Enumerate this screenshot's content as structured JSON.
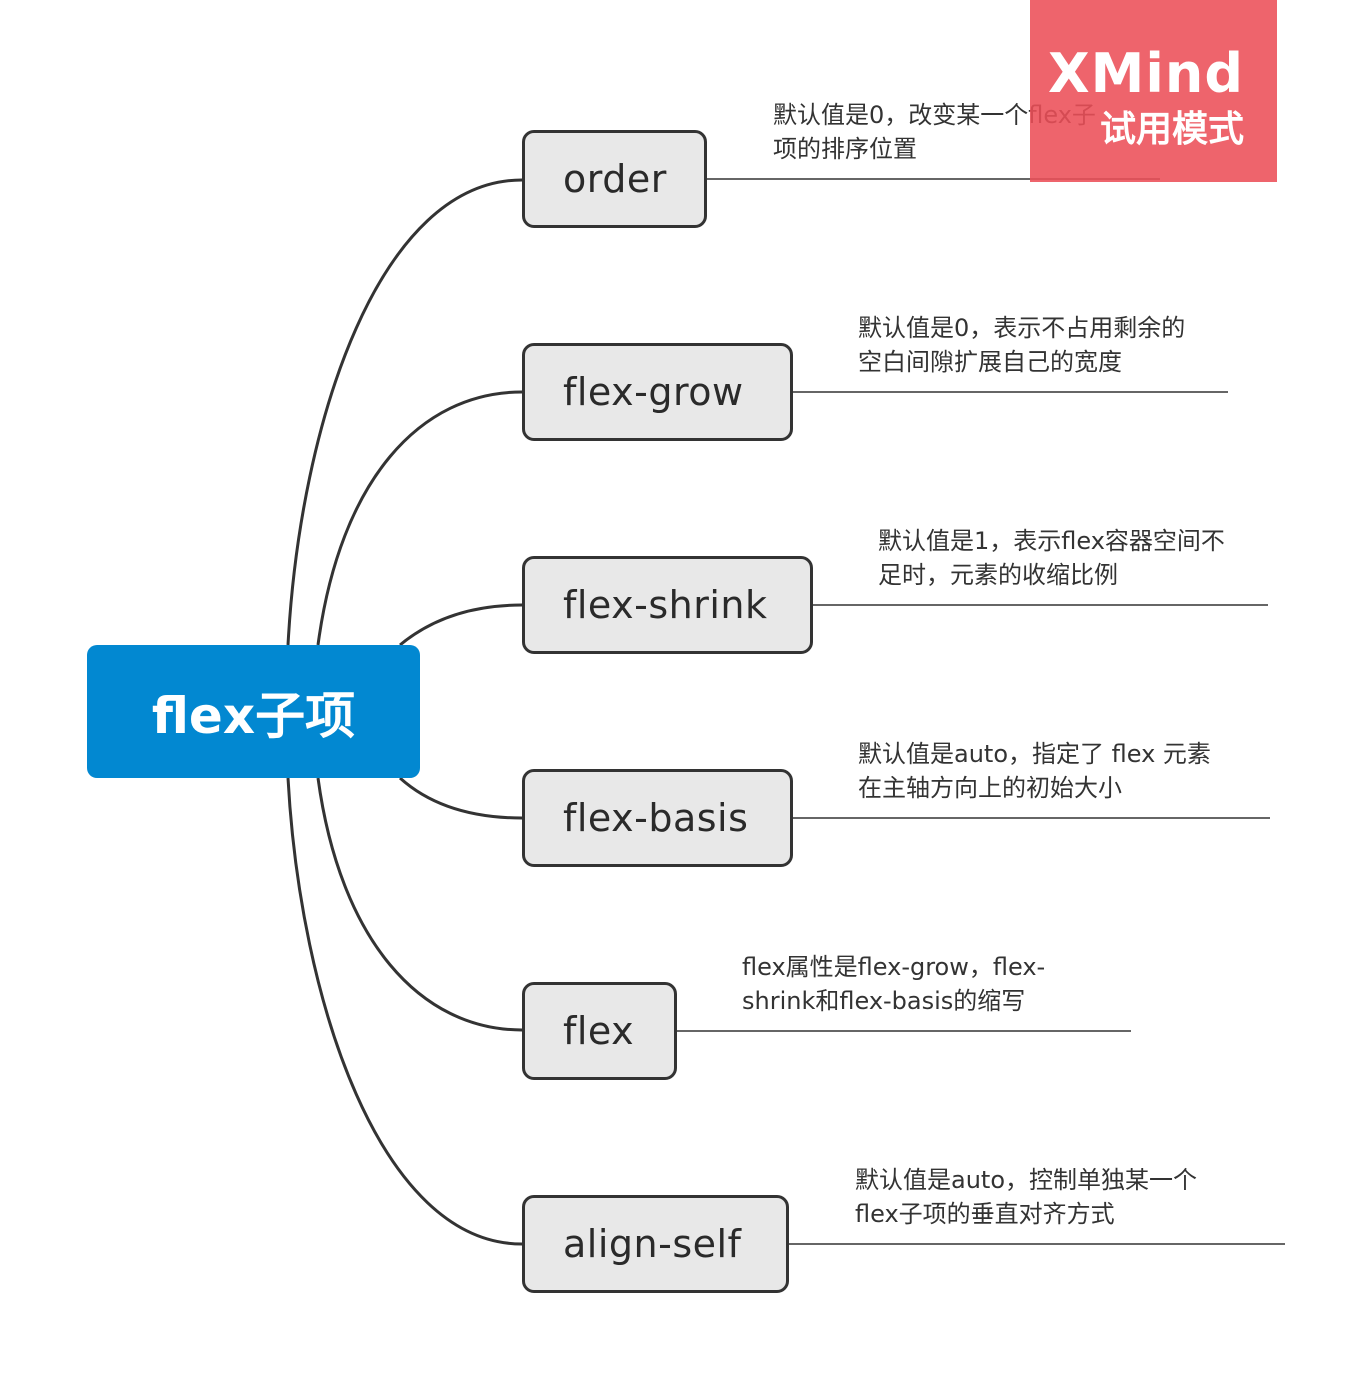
{
  "root": {
    "label": "flex子项"
  },
  "branches": [
    {
      "label": "order",
      "note": [
        "默认值是0，改变某一个flex子",
        "项的排序位置"
      ]
    },
    {
      "label": "flex-grow",
      "note": [
        "默认值是0，表示不占用剩余的",
        "空白间隙扩展自己的宽度"
      ]
    },
    {
      "label": "flex-shrink",
      "note": [
        "默认值是1，表示flex容器空间不",
        "足时，元素的收缩比例"
      ]
    },
    {
      "label": "flex-basis",
      "note": [
        "默认值是auto，指定了 flex 元素",
        "在主轴方向上的初始大小"
      ]
    },
    {
      "label": "flex",
      "note": [
        "flex属性是flex-grow，flex-",
        "shrink和flex-basis的缩写"
      ]
    },
    {
      "label": "align-self",
      "note": [
        "默认值是auto，控制单独某一个",
        "flex子项的垂直对齐方式"
      ]
    }
  ],
  "watermark": {
    "brand": "XMind",
    "mode": "试用模式"
  },
  "colors": {
    "root_fill": "#0288d1",
    "branch_fill": "#e8e8e8",
    "branch_border": "#333333",
    "connector": "#333333",
    "watermark": "#ec4e58"
  }
}
